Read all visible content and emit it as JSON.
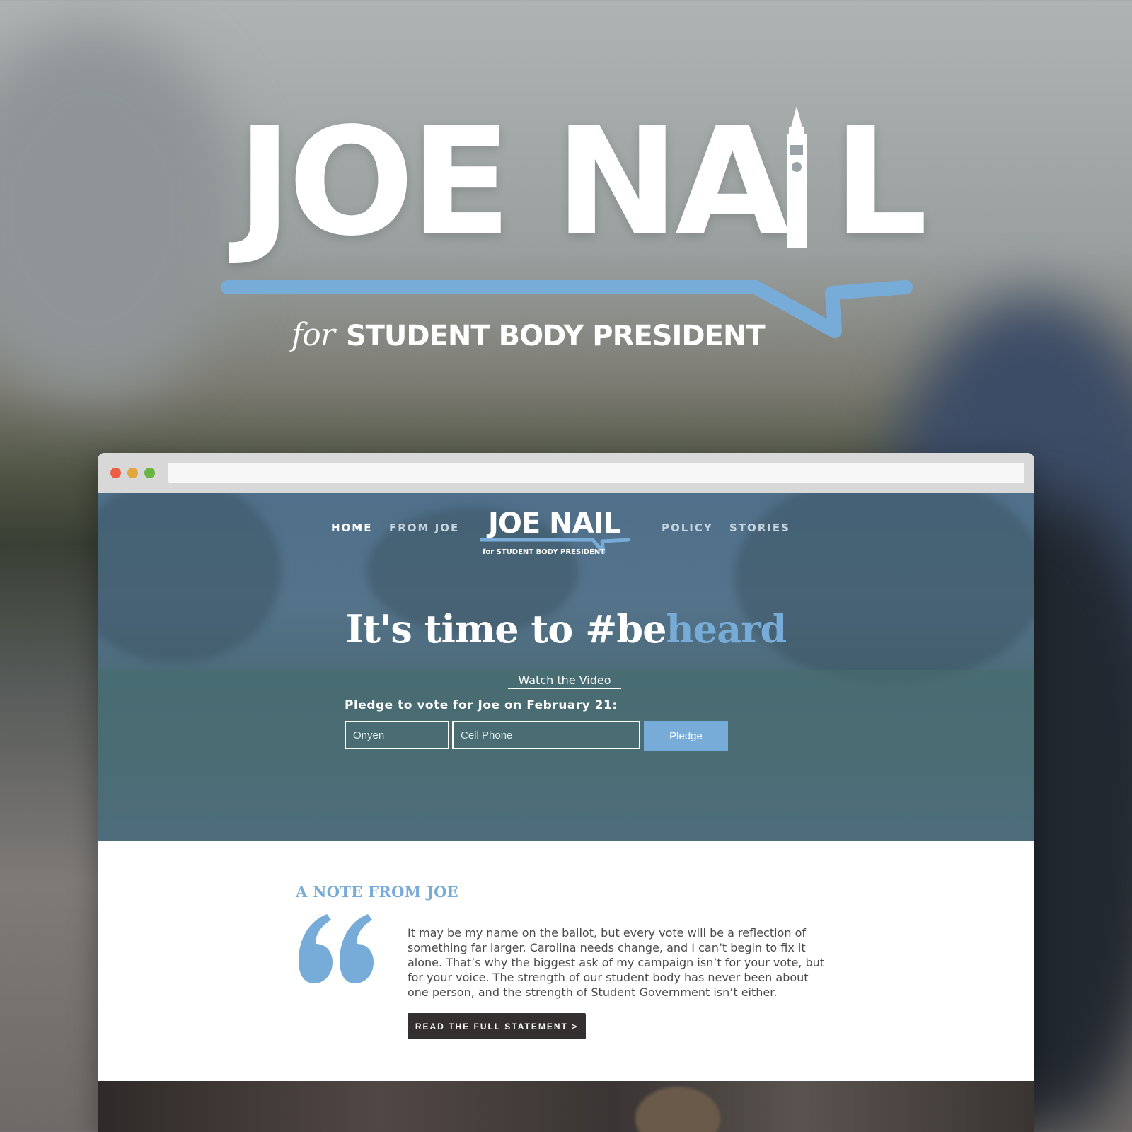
{
  "hero": {
    "name": "JOE NA L",
    "for": "for",
    "title": "STUDENT BODY PRESIDENT",
    "colors": {
      "accent": "#78acd8",
      "text": "#ffffff"
    }
  },
  "site": {
    "nav": {
      "home": "HOME",
      "from_joe": "FROM JOE",
      "policy": "POLICY",
      "stories": "STORIES"
    },
    "logo": {
      "name": "JOE NAIL",
      "tagline": "for STUDENT BODY PRESIDENT"
    },
    "headline": {
      "main": "It's time to #be",
      "accent": "heard"
    },
    "watch_video": "Watch the Video",
    "pledge": {
      "label": "Pledge to vote for Joe on February 21:",
      "onyen_placeholder": "Onyen",
      "phone_placeholder": "Cell Phone",
      "button": "Pledge"
    },
    "note": {
      "heading": "A NOTE FROM JOE",
      "quote_icon": "quote-icon",
      "body": "It may be my name on the ballot, but every vote will be a reflection of something far larger. Carolina needs change, and I can’t begin to fix it alone. That’s why the biggest ask of my campaign isn’t for your vote, but for your voice. The strength of our student body has never been about one person, and the strength of Student Government isn’t either.",
      "button": "READ THE FULL STATEMENT >"
    }
  }
}
